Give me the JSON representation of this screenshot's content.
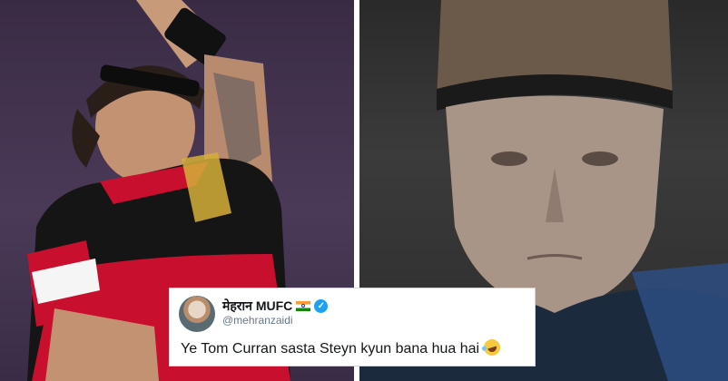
{
  "tweet": {
    "display_name": "मेहरान MUFC",
    "handle": "@mehranzaidi",
    "text": "Ye Tom Curran sasta Steyn kyun bana hua hai",
    "flag_icon": "india-flag-icon",
    "verified_icon": "verified-badge-icon",
    "emoji_icon": "rolling-on-floor-laughing-emoji-icon"
  },
  "colors": {
    "left_background": "#3a2b45",
    "jersey_red": "#c8102e",
    "jersey_black": "#151515",
    "jersey_gold": "#d4af37",
    "right_background": "#2f2f2f",
    "verified_blue": "#1da1f2"
  }
}
